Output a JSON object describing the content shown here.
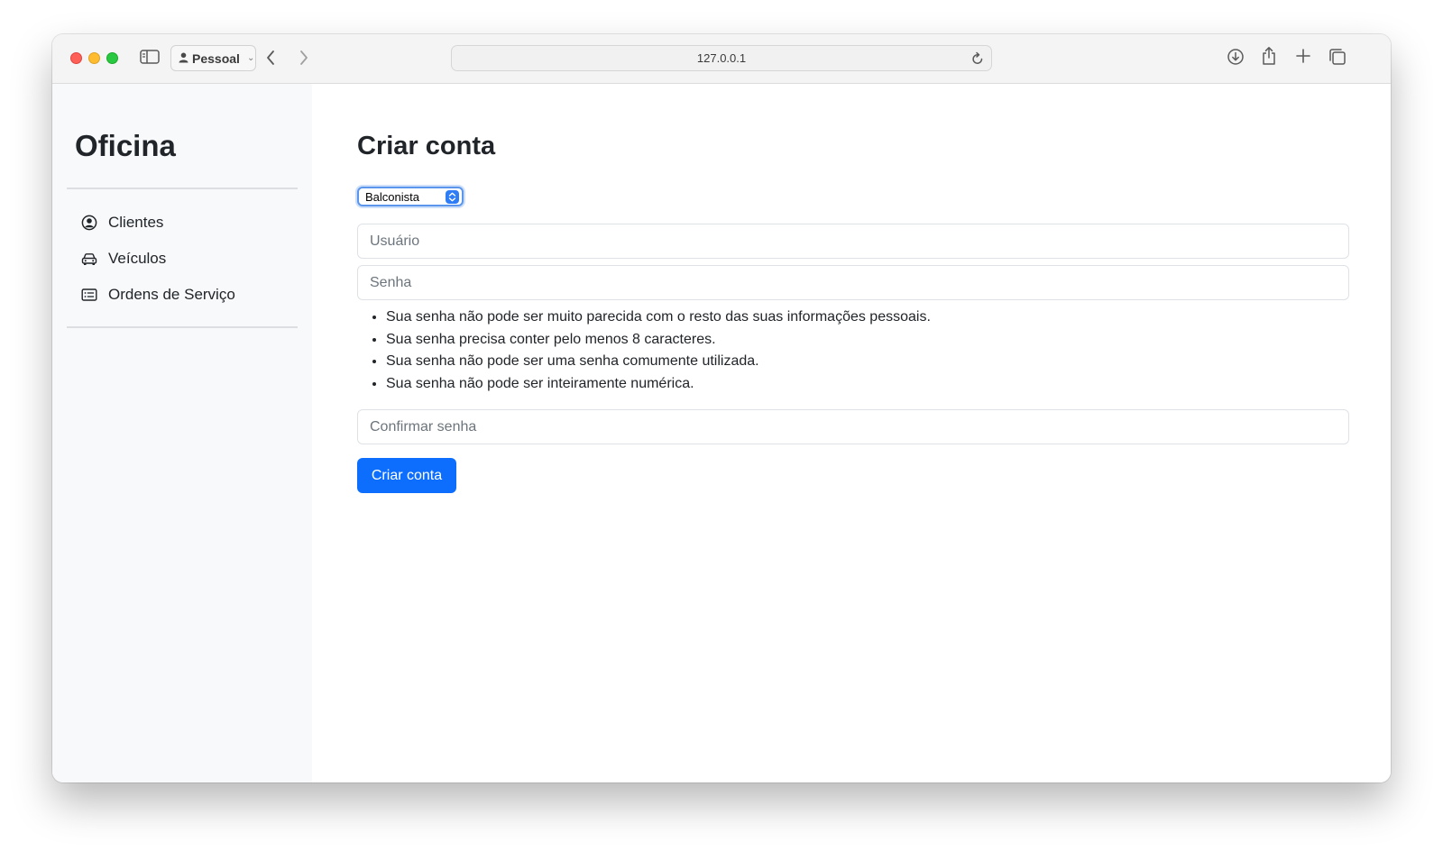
{
  "browser": {
    "profile_label": "Pessoal",
    "url": "127.0.0.1",
    "icons": [
      "sidebar-toggle-icon",
      "person-icon",
      "back-icon",
      "forward-icon",
      "reload-icon",
      "download-icon",
      "share-icon",
      "new-tab-icon",
      "tab-overview-icon"
    ]
  },
  "sidebar": {
    "brand": "Oficina",
    "items": [
      {
        "label": "Clientes",
        "icon": "person-circle-icon"
      },
      {
        "label": "Veículos",
        "icon": "car-icon"
      },
      {
        "label": "Ordens de Serviço",
        "icon": "list-card-icon"
      }
    ]
  },
  "main": {
    "title": "Criar conta",
    "role_select": {
      "value": "Balconista"
    },
    "username_placeholder": "Usuário",
    "password_placeholder": "Senha",
    "password_rules": [
      "Sua senha não pode ser muito parecida com o resto das suas informações pessoais.",
      "Sua senha precisa conter pelo menos 8 caracteres.",
      "Sua senha não pode ser uma senha comumente utilizada.",
      "Sua senha não pode ser inteiramente numérica."
    ],
    "confirm_placeholder": "Confirmar senha",
    "submit_label": "Criar conta"
  },
  "colors": {
    "primary": "#0d6efd",
    "sidebar_bg": "#f8f9fa",
    "select_focus": "#5b96ec"
  }
}
